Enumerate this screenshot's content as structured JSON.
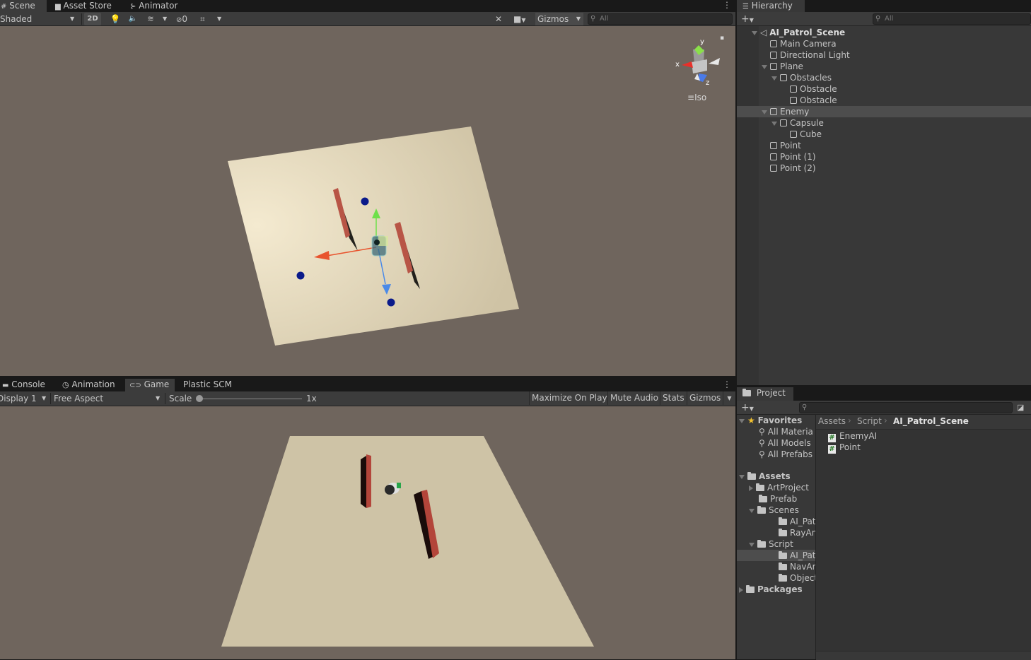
{
  "scene_tabs": [
    "Scene",
    "Asset Store",
    "Animator"
  ],
  "scene_toolbar": {
    "shading_mode": "Shaded",
    "mode_2d": "2D",
    "hidden_count": "0",
    "gizmos_label": "Gizmos",
    "search_placeholder": "All"
  },
  "scene_view": {
    "projection_label": "Iso",
    "gizmo_x": "x",
    "gizmo_y": "y",
    "gizmo_z": "z"
  },
  "game_tabs": [
    "Console",
    "Animation",
    "Game",
    "Plastic SCM"
  ],
  "game_toolbar": {
    "display": "Display 1",
    "aspect": "Free Aspect",
    "scale_label": "Scale",
    "scale_value": "1x",
    "maximize": "Maximize On Play",
    "mute": "Mute Audio",
    "stats": "Stats",
    "gizmos": "Gizmos"
  },
  "hierarchy": {
    "tab_label": "Hierarchy",
    "search_placeholder": "All",
    "items": [
      {
        "label": "AI_Patrol_Scene",
        "depth": 0,
        "expanded": true,
        "kind": "scene"
      },
      {
        "label": "Main Camera",
        "depth": 1,
        "kind": "object"
      },
      {
        "label": "Directional Light",
        "depth": 1,
        "kind": "object"
      },
      {
        "label": "Plane",
        "depth": 1,
        "expanded": true,
        "kind": "object"
      },
      {
        "label": "Obstacles",
        "depth": 2,
        "expanded": true,
        "kind": "object"
      },
      {
        "label": "Obstacle",
        "depth": 3,
        "kind": "object"
      },
      {
        "label": "Obstacle",
        "depth": 3,
        "kind": "object"
      },
      {
        "label": "Enemy",
        "depth": 1,
        "expanded": true,
        "kind": "object",
        "selected": true
      },
      {
        "label": "Capsule",
        "depth": 2,
        "expanded": true,
        "kind": "object"
      },
      {
        "label": "Cube",
        "depth": 3,
        "kind": "object"
      },
      {
        "label": "Point",
        "depth": 1,
        "kind": "object"
      },
      {
        "label": "Point (1)",
        "depth": 1,
        "kind": "object"
      },
      {
        "label": "Point (2)",
        "depth": 1,
        "kind": "object"
      }
    ]
  },
  "project": {
    "tab_label": "Project",
    "favorites_label": "Favorites",
    "favorites": [
      "All Materia",
      "All Models",
      "All Prefabs"
    ],
    "assets_label": "Assets",
    "tree": [
      {
        "label": "ArtProject",
        "depth": 1,
        "collapsed": true
      },
      {
        "label": "Prefab",
        "depth": 1
      },
      {
        "label": "Scenes",
        "depth": 1,
        "expanded": true
      },
      {
        "label": "AI_Patro",
        "depth": 2
      },
      {
        "label": "RayAnsł",
        "depth": 2
      },
      {
        "label": "Script",
        "depth": 1,
        "expanded": true
      },
      {
        "label": "AI_Patro",
        "depth": 2,
        "selected": true
      },
      {
        "label": "NavAndi",
        "depth": 2
      },
      {
        "label": "ObjectP",
        "depth": 2
      }
    ],
    "packages_label": "Packages",
    "breadcrumb": [
      "Assets",
      "Script",
      "AI_Patrol_Scene"
    ],
    "files": [
      "EnemyAI",
      "Point"
    ]
  },
  "colors": {
    "panel": "#383838",
    "selection": "#4d4d4d",
    "viewport_bg": "#6f655d",
    "plane": "#e6dcbf",
    "obstacle": "#b85546"
  }
}
